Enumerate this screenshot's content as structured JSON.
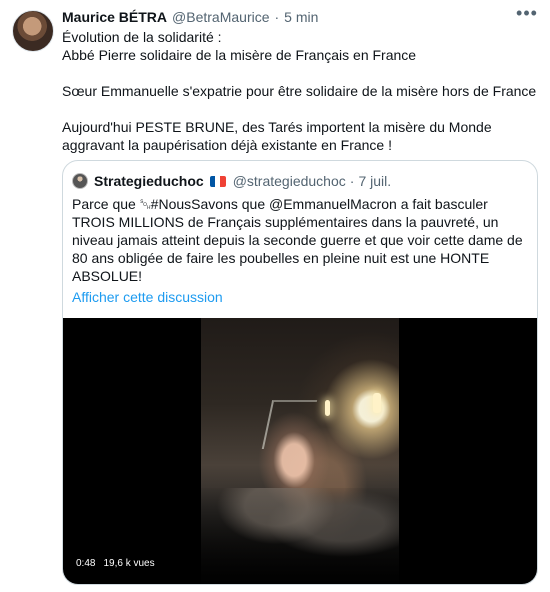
{
  "tweet": {
    "author": {
      "display_name": "Maurice BÉTRA",
      "handle": "@BetraMaurice",
      "separator": "·",
      "time": "5 min"
    },
    "more_icon": "more-horizontal-icon",
    "text_lines": [
      "Évolution de la solidarité :",
      "Abbé Pierre solidaire de la misère de Français en France",
      "",
      "Sœur Emmanuelle s'expatrie pour être solidaire de la misère hors de France",
      "",
      "Aujourd'hui PESTE BRUNE, des Tarés importent la misère du Monde",
      "aggravant la paupérisation déjà existante en France !"
    ]
  },
  "quoted_tweet": {
    "author": {
      "display_name": "Strategieduchoc",
      "flag_icon": "french-flag-icon",
      "handle": "@strategieduchoc",
      "separator": "·",
      "time": "7 juil."
    },
    "text_lines": [
      "Parce que ␁#NousSavons que @EmmanuelMacron a fait basculer",
      "TROIS MILLIONS de Français supplémentaires dans la pauvreté, un",
      "niveau jamais atteint depuis la seconde guerre et que voir cette dame de",
      "80 ans obligée de faire les poubelles en pleine nuit est une HONTE",
      "ABSOLUE!"
    ],
    "show_thread_label": "Afficher cette discussion",
    "video": {
      "duration": "0:48",
      "views": "19,6 k vues"
    }
  },
  "colors": {
    "text": "#0f1419",
    "secondary_text": "#536471",
    "link": "#1d9bf0",
    "border": "#cfd9de",
    "video_background": "#000000"
  }
}
